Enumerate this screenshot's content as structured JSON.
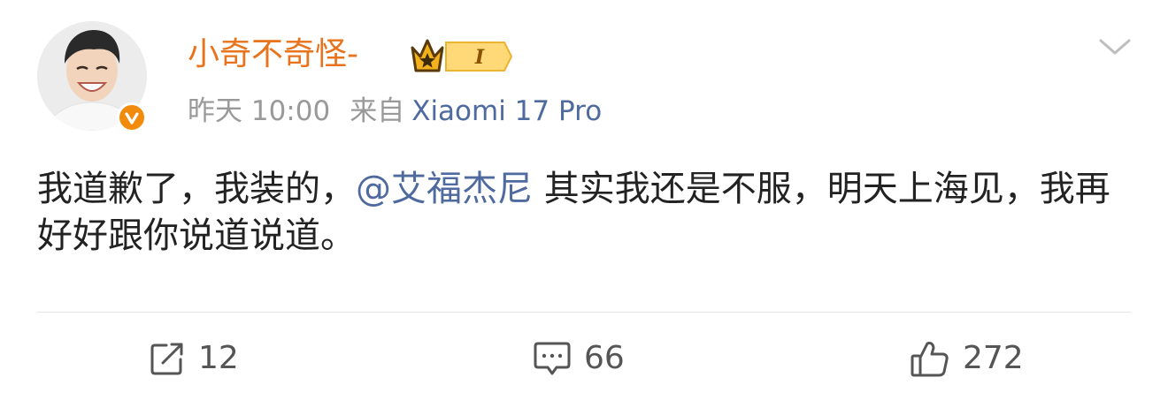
{
  "post": {
    "username": "小奇不奇怪-",
    "vip_level": "I",
    "time": "昨天 10:00",
    "source_label": "来自",
    "device": "Xiaomi 17 Pro",
    "text_before": "我道歉了，我装的，",
    "mention": "@艾福杰尼",
    "text_after": " 其实我还是不服，明天上海见，我再好好跟你说道说道。"
  },
  "actions": {
    "repost_count": "12",
    "comment_count": "66",
    "like_count": "272"
  },
  "colors": {
    "username": "#e8731d",
    "mention_link": "#4e6a9e",
    "meta_gray": "#999999",
    "verified_badge": "#f28b0c"
  },
  "icons": [
    "avatar",
    "verified-icon",
    "crown-icon",
    "vip-badge",
    "chevron-down-icon",
    "repost-icon",
    "comment-icon",
    "like-icon"
  ]
}
